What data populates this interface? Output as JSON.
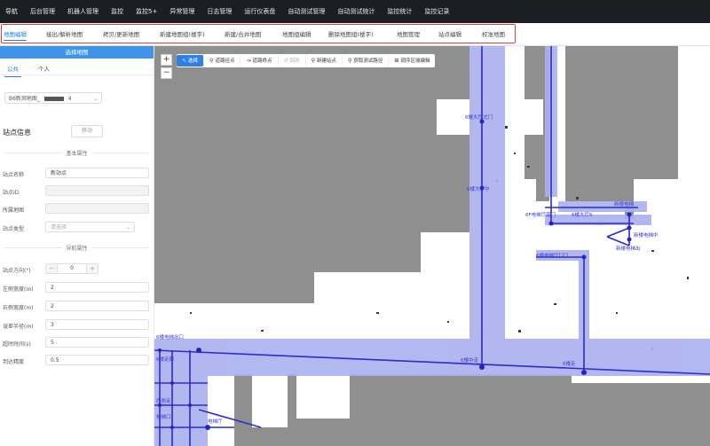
{
  "topnav": [
    "导航",
    "后台管理",
    "机器人管理",
    "监控",
    "监控5+",
    "异常管理",
    "日志管理",
    "运行仪表盘",
    "自动测试管理",
    "自动测试统计",
    "监控统计",
    "监控记录"
  ],
  "tabs": [
    "地图编辑",
    "接出/解析地图",
    "拷贝/更新地图",
    "新建地图组(楼字)",
    "新建/合并地图",
    "地图组编辑",
    "删除地图组(楼字)",
    "地图管理",
    "站点编辑",
    "校准地图"
  ],
  "panel": {
    "title": "选择地图",
    "tabs": [
      "公共",
      "个人"
    ],
    "map_select": "B6新测地图_",
    "map_select_suffix": "4",
    "site_info_title": "站点信息",
    "move_button": "移动",
    "basic_section": "基本属性",
    "nav_section": "导航属性",
    "fields": {
      "site_name_label": "站点名称",
      "site_name_value": "新站点",
      "site_id_label": "站点ID",
      "site_id_value": "",
      "map_label": "所属地图",
      "map_value": "",
      "site_type_label": "站点类型",
      "site_type_placeholder": "请选择",
      "direction_label": "站点方向(°)",
      "direction_value": "0",
      "left_width_label": "左侧宽度(m)",
      "left_width_value": "2",
      "right_width_label": "右侧宽度(m)",
      "right_width_value": "2",
      "tolerance_label": "误差半径(m)",
      "tolerance_value": "3",
      "timeout_label": "超时时间(s)",
      "timeout_value": "5",
      "precision_label": "到达精度",
      "precision_value": "0.5"
    }
  },
  "map": {
    "zoom_in": "+",
    "zoom_out": "−",
    "toolbar": [
      {
        "label": "选择",
        "icon": "cursor-icon",
        "glyph": "↖",
        "state": "active"
      },
      {
        "label": "道路径点",
        "icon": "pin-icon",
        "glyph": "⚲",
        "state": "normal"
      },
      {
        "label": "道路终点",
        "icon": "path-icon",
        "glyph": "↝",
        "state": "normal"
      },
      {
        "label": "回到",
        "icon": "undo-icon",
        "glyph": "↺",
        "state": "disabled"
      },
      {
        "label": "新建站点",
        "icon": "location-icon",
        "glyph": "⚲",
        "state": "normal"
      },
      {
        "label": "获取测试路径",
        "icon": "location-icon",
        "glyph": "⚲",
        "state": "normal"
      },
      {
        "label": "调序区域编辑",
        "icon": "grid-icon",
        "glyph": "⊞",
        "state": "normal"
      }
    ],
    "labels": [
      "6楼大厅北门",
      "6楼大厅中",
      "6F电梯厅南门",
      "6楼大厅6",
      "新楼电梯",
      "6楼电梯厅门口",
      "新楼电梯出",
      "6楼电梯出口",
      "新楼电梯中",
      "6楼中走",
      "6楼走",
      "6楼走廊",
      "西侧走",
      "楼梯口",
      "电梯厅"
    ],
    "colors": {
      "road": "#2b2bd1",
      "corridor": "#aab0ee",
      "free": "#ffffff",
      "unknown": "#8f8f8f"
    }
  }
}
